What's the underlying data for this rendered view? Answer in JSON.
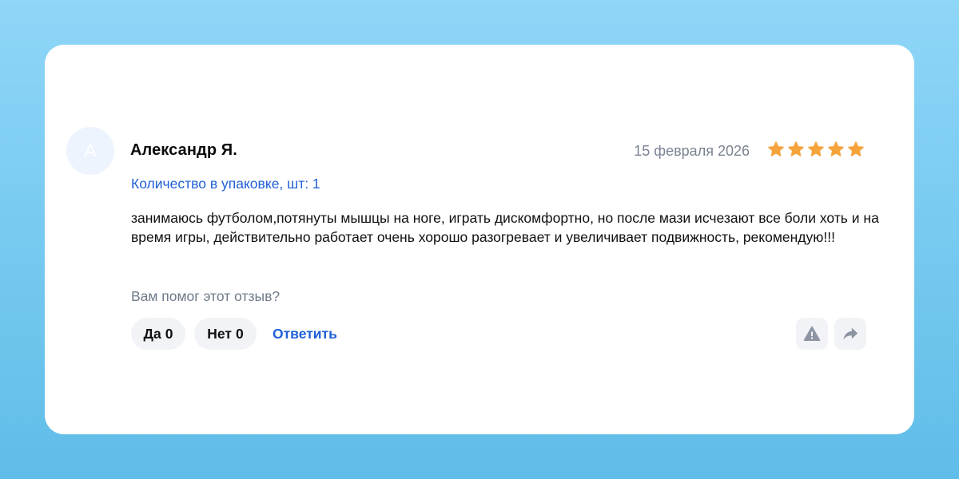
{
  "review": {
    "avatar_letter": "А",
    "author": "Александр Я.",
    "date": "15 февраля 2026",
    "rating": 5,
    "rating_max": 5,
    "variant": "Количество в упаковке, шт: 1",
    "text": "занимаюсь футболом,потянуты мышцы на ноге, играть дискомфортно, но после мази исчезают все боли хоть и на время игры, действительно работает очень хорошо разогревает и увеличивает подвижность, рекомендую!!!"
  },
  "helpful": {
    "question": "Вам помог этот отзыв?",
    "yes_label": "Да",
    "yes_count": "0",
    "no_label": "Нет",
    "no_count": "0",
    "reply_label": "Ответить"
  },
  "icons": {
    "star": "star-icon",
    "report": "warning-icon",
    "share": "share-arrow-icon"
  },
  "colors": {
    "star": "#f5a33b",
    "link": "#1f5fd6",
    "muted_text": "#7a8391",
    "pill_bg": "#f1f3f6",
    "icon_gray": "#8d95a3",
    "background_top": "#8fd6f8",
    "background_bottom": "#5fbde8"
  }
}
